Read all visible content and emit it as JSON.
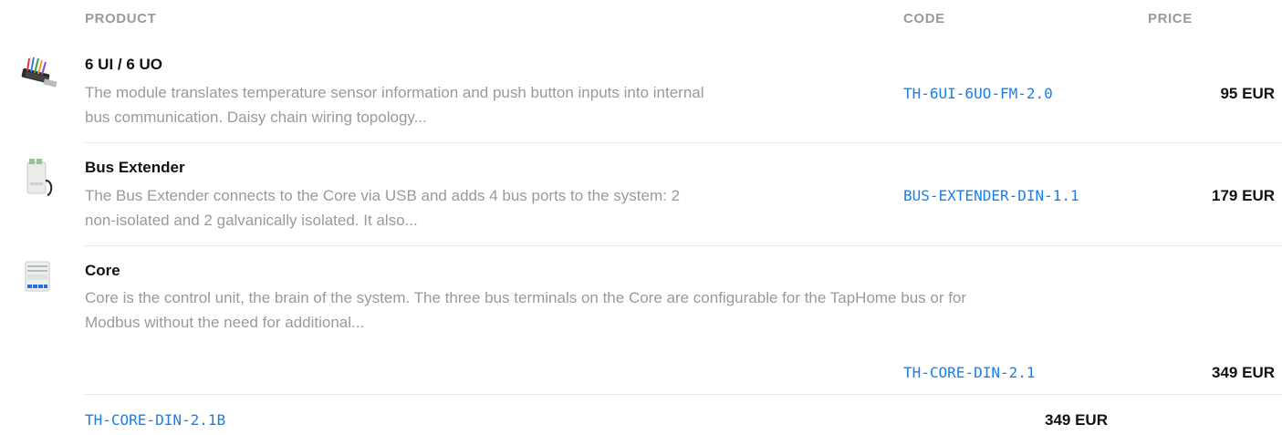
{
  "headers": {
    "product": "PRODUCT",
    "code": "CODE",
    "price": "PRICE"
  },
  "products": [
    {
      "icon": "io-module-image",
      "title": "6 UI / 6 UO",
      "desc_line1": "The module translates temperature sensor information and push button inputs into internal",
      "desc_line2": "bus communication. Daisy chain wiring topology...",
      "code": "TH-6UI-6UO-FM-2.0",
      "price": "95 EUR"
    },
    {
      "icon": "bus-extender-image",
      "title": "Bus Extender",
      "desc_line1": "The Bus Extender connects to the Core via USB and adds 4 bus ports to the system: 2",
      "desc_line2": "non-isolated and 2 galvanically isolated. It also...",
      "code": "BUS-EXTENDER-DIN-1.1",
      "price": "179 EUR"
    },
    {
      "icon": "core-image",
      "title": "Core",
      "desc_line1": "Core is the control unit, the brain of the system. The three bus terminals on the Core are configurable for the TapHome bus or for",
      "desc_line2": "Modbus without the need for additional...",
      "variants": [
        {
          "code": "TH-CORE-DIN-2.1",
          "price": "349 EUR"
        },
        {
          "code": "TH-CORE-DIN-2.1B",
          "price": "349 EUR"
        }
      ]
    }
  ],
  "colors": {
    "link": "#1780ec",
    "muted": "#9a9a9a",
    "text": "#111111",
    "divider": "#e6e6e6"
  }
}
